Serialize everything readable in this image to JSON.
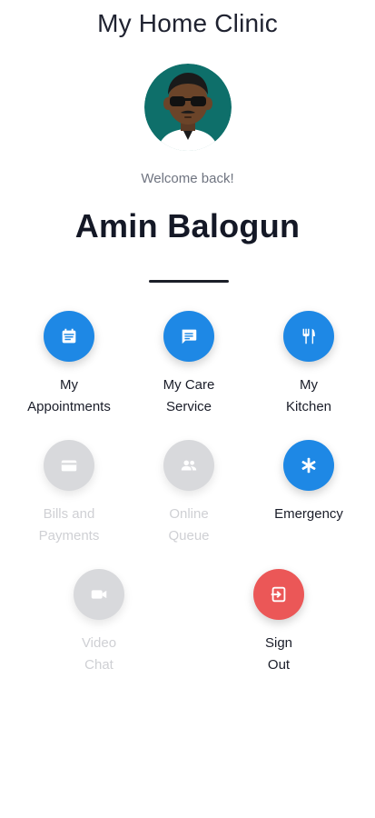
{
  "header": {
    "title": "My Home Clinic"
  },
  "profile": {
    "avatar_icon": "user-avatar-icon",
    "welcome": "Welcome back!",
    "name": "Amin Balogun"
  },
  "colors": {
    "accent_blue": "#1e88e5",
    "danger_red": "#eb5757",
    "disabled_grey": "#d8d9dc"
  },
  "menu": [
    {
      "icon": "calendar-icon",
      "line1": "My",
      "line2": "Appointments",
      "enabled": true
    },
    {
      "icon": "chat-message-icon",
      "line1": "My Care",
      "line2": "Service",
      "enabled": true
    },
    {
      "icon": "restaurant-icon",
      "line1": "My",
      "line2": "Kitchen",
      "enabled": true
    },
    {
      "icon": "credit-card-icon",
      "line1": "Bills and",
      "line2": "Payments",
      "enabled": false
    },
    {
      "icon": "people-icon",
      "line1": "Online",
      "line2": "Queue",
      "enabled": false
    },
    {
      "icon": "asterisk-icon",
      "line1": "Emergency",
      "line2": "",
      "enabled": true
    },
    {
      "icon": "video-camera-icon",
      "line1": "Video",
      "line2": "Chat",
      "enabled": false
    },
    {
      "icon": "sign-out-icon",
      "line1": "Sign",
      "line2": "Out",
      "enabled": true
    }
  ]
}
